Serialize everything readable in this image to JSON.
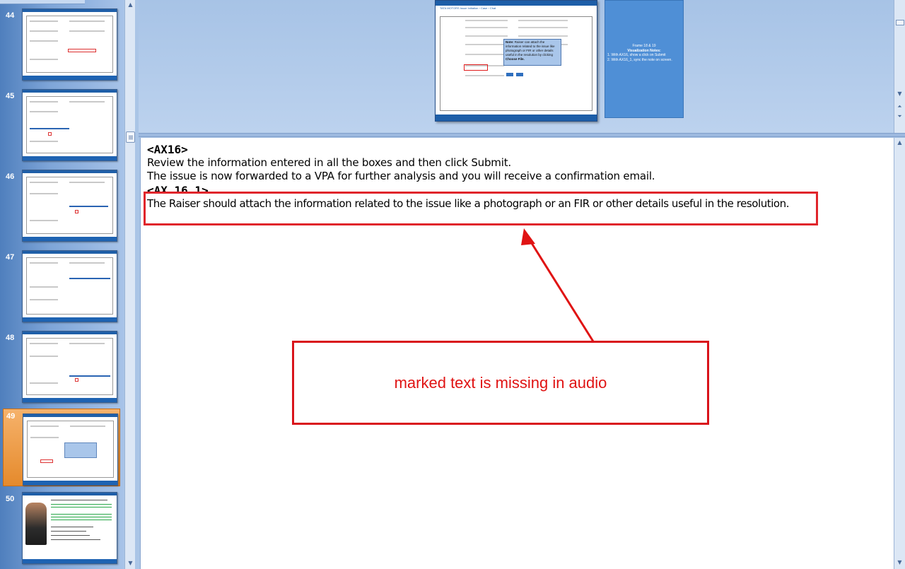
{
  "slides": [
    {
      "number": "44",
      "selected": false,
      "kind": "form"
    },
    {
      "number": "45",
      "selected": false,
      "kind": "form"
    },
    {
      "number": "46",
      "selected": false,
      "kind": "form"
    },
    {
      "number": "47",
      "selected": false,
      "kind": "form"
    },
    {
      "number": "48",
      "selected": false,
      "kind": "form"
    },
    {
      "number": "49",
      "selected": true,
      "kind": "form-note"
    },
    {
      "number": "50",
      "selected": false,
      "kind": "avatar"
    }
  ],
  "preview": {
    "header": "TATA MOTORS   Issue Initiation  ›  Case  ›  Chat",
    "note": {
      "label": "Note:",
      "text": "Raiser can attach the information related to the issue like photograph or FIR or other details useful in the resolution by clicking",
      "action": "Choose File."
    },
    "side_notes": {
      "frame": "Frame 18 & 19",
      "heading": "Visualization Notes:",
      "items": [
        "1.  With AX16, show a click on Submit",
        "2.  With AX16_1, sync the note on screen."
      ]
    }
  },
  "notes": {
    "tag1": "<AX16>",
    "line1": "Review the information entered in all the boxes and then click Submit.",
    "line2": "The issue is now forwarded to a VPA for further analysis and you will receive a confirmation email.",
    "tag2": "<AX_16_1>",
    "line3": "The Raiser should attach the information related to the issue like a photograph or an FIR or other details useful  in the resolution."
  },
  "annotation": {
    "callout": "marked text is missing in audio",
    "color": "#e01313"
  }
}
